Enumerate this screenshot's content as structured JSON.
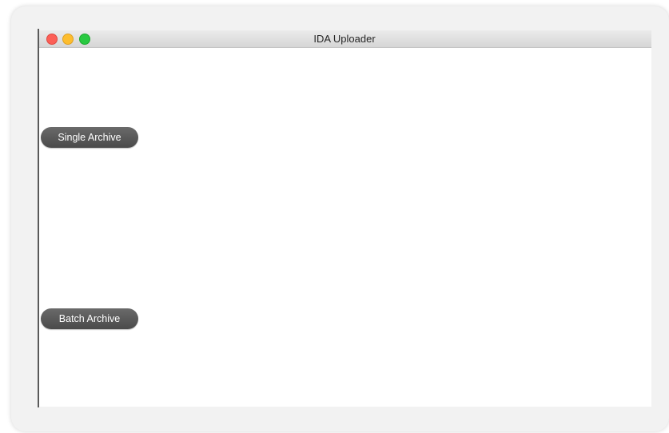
{
  "window": {
    "title": "IDA Uploader"
  },
  "buttons": {
    "single_archive": "Single Archive",
    "batch_archive": "Batch Archive"
  },
  "colors": {
    "close": "#fc5f57",
    "minimize": "#fdbd2e",
    "maximize": "#29c941",
    "button_bg": "#5a5a5a"
  }
}
